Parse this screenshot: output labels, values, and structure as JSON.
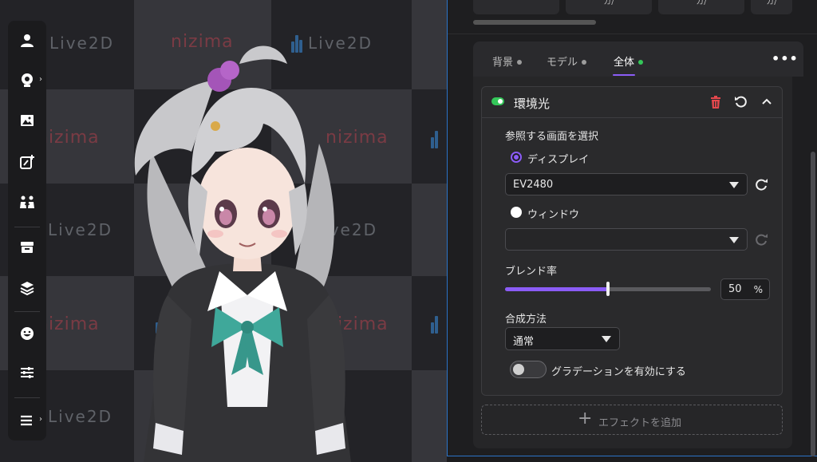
{
  "stage": {
    "watermark_live2d": "Live2D",
    "watermark_nizima": "nizima",
    "checker_colors": {
      "dark": "#232327",
      "light": "#36363b"
    }
  },
  "toolbar": {
    "items": [
      {
        "name": "user-icon"
      },
      {
        "name": "webcam-icon",
        "has_submenu": true
      },
      {
        "name": "image-icon"
      },
      {
        "name": "add-sticker-icon"
      },
      {
        "name": "people-icon"
      },
      {
        "name": "inbox-icon"
      },
      {
        "name": "layers-icon"
      },
      {
        "name": "smile-face-icon"
      },
      {
        "name": "sliders-icon"
      },
      {
        "name": "menu-icon",
        "has_submenu": true
      }
    ],
    "submenu_arrow": "›"
  },
  "panel": {
    "top_cards": [
      "ガ/",
      "ガ/",
      "ガ/"
    ],
    "tabs": [
      {
        "label": "背景",
        "active": false
      },
      {
        "label": "モデル",
        "active": false
      },
      {
        "label": "全体",
        "active": true
      }
    ],
    "more_label": "•••",
    "accent_color": "#8b5cf6",
    "active_dot_color": "#34c759",
    "effect": {
      "title": "環境光",
      "enabled": true,
      "source_label": "参照する画面を選択",
      "display_option": "ディスプレイ",
      "display_selected": true,
      "display_value": "EV2480",
      "window_option": "ウィンドウ",
      "window_selected": false,
      "window_value": "",
      "blend_label": "ブレンド率",
      "blend_value": "50",
      "blend_unit": "%",
      "blend_fraction": 0.5,
      "composite_label": "合成方法",
      "composite_value": "通常",
      "gradient_label": "グラデーションを有効にする",
      "gradient_enabled": false
    },
    "add_effect_label": "エフェクトを追加",
    "add_effect_plus": "+"
  }
}
